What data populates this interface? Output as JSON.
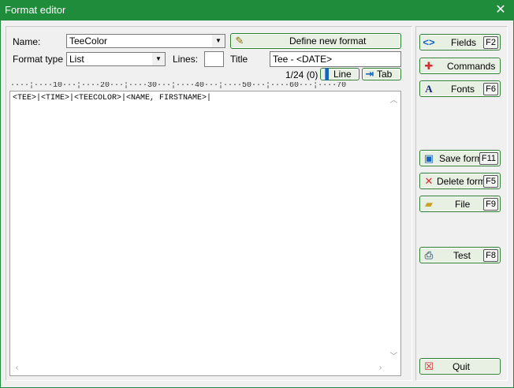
{
  "window": {
    "title": "Format editor",
    "close_glyph": "✕"
  },
  "form": {
    "name_label": "Name:",
    "name_value": "TeeColor",
    "define_button": "Define new format",
    "format_type_label": "Format type",
    "format_type_value": "List",
    "lines_label": "Lines:",
    "lines_value": "",
    "title_label": "Title",
    "title_value": "Tee - <DATE>",
    "position": "1/24 (0)",
    "line_button": "Line",
    "tab_button": "Tab"
  },
  "ruler": "····¦····10···¦····20···¦····30···¦····40···¦····50···¦····60···¦····70",
  "editor": {
    "content": "<TEE>|<TIME>|<TEECOLOR>|<NAME, FIRSTNAME>|"
  },
  "side": {
    "fields": {
      "label": "Fields",
      "key": "F2",
      "icon": "brackets-icon"
    },
    "commands": {
      "label": "Commands",
      "icon": "plus-icon"
    },
    "fonts": {
      "label": "Fonts",
      "key": "F6",
      "icon": "font-icon"
    },
    "save": {
      "label": "Save format",
      "key": "F11",
      "icon": "floppy-icon"
    },
    "delete": {
      "label": "Delete format",
      "key": "F5",
      "icon": "x-icon"
    },
    "file": {
      "label": "File",
      "key": "F9",
      "icon": "folder-icon"
    },
    "test": {
      "label": "Test",
      "key": "F8",
      "icon": "printer-icon"
    },
    "quit": {
      "label": "Quit",
      "icon": "exit-icon"
    }
  },
  "colors": {
    "titlebar": "#1e8c3a",
    "button_border": "#2e7d32"
  }
}
